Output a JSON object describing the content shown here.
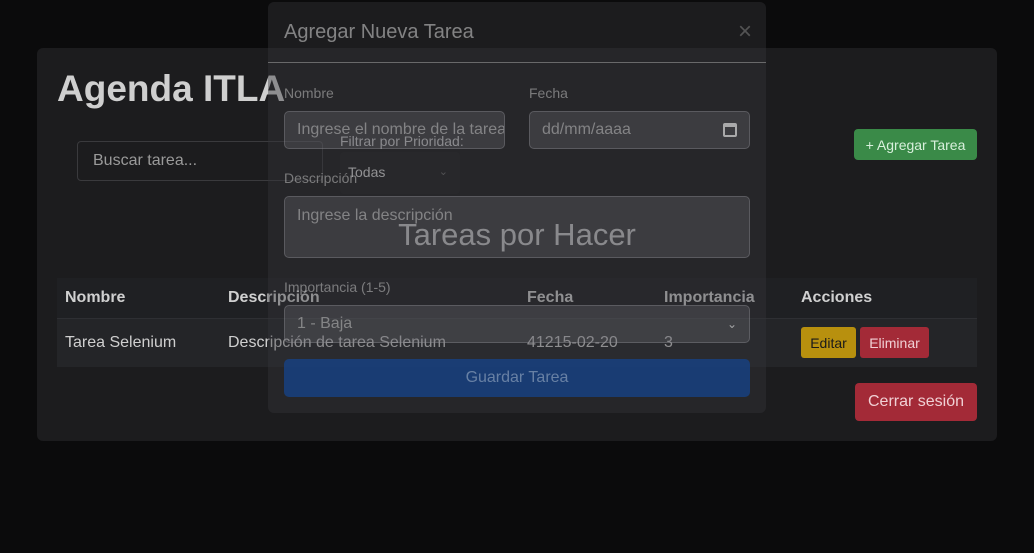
{
  "page": {
    "title": "Agenda ITLA",
    "search_placeholder": "Buscar tarea...",
    "filter_label": "Filtrar por Prioridad:",
    "filter_value": "Todas",
    "add_button": "+ Agregar Tarea",
    "section_title": "Tareas por Hacer",
    "logout_button": "Cerrar sesión"
  },
  "table": {
    "headers": [
      "Nombre",
      "Descripción",
      "Fecha",
      "Importancia",
      "Acciones"
    ],
    "rows": [
      {
        "nombre": "Tarea Selenium",
        "descripcion": "Descripción de tarea Selenium",
        "fecha": "41215-02-20",
        "importancia": "3",
        "edit_label": "Editar",
        "delete_label": "Eliminar"
      }
    ]
  },
  "modal": {
    "title": "Agregar Nueva Tarea",
    "close_glyph": "×",
    "name_label": "Nombre",
    "name_placeholder": "Ingrese el nombre de la tarea",
    "date_label": "Fecha",
    "date_placeholder": "dd/mm/aaaa",
    "desc_label": "Descripción",
    "desc_placeholder": "Ingrese la descripción",
    "importance_label": "Importancia (1-5)",
    "importance_value": "1 - Baja",
    "save_button": "Guardar Tarea"
  },
  "colors": {
    "background": "#0b0b0c",
    "card": "#1c1c1e",
    "success": "#3a8a48",
    "warning": "#b8900e",
    "danger": "#a32a37",
    "primary": "#16448c"
  }
}
